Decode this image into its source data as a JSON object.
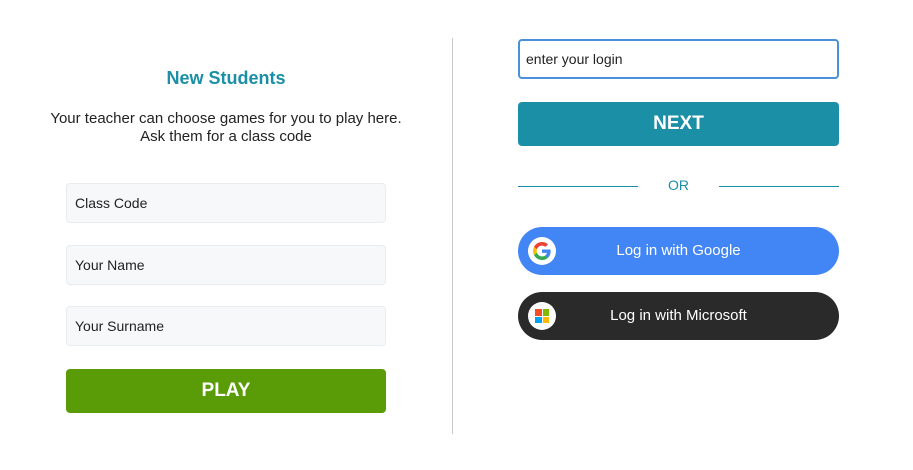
{
  "new_students": {
    "title": "New Students",
    "description_line1": "Your teacher can choose games for you to play here.",
    "description_line2": "Ask them for a class code",
    "class_code_placeholder": "Class Code",
    "name_placeholder": "Your Name",
    "surname_placeholder": "Your Surname",
    "play_label": "PLAY"
  },
  "login": {
    "login_placeholder": "enter your login",
    "next_label": "NEXT",
    "or_label": "OR",
    "google_label": "Log in with Google",
    "microsoft_label": "Log in with Microsoft"
  },
  "colors": {
    "accent": "#1a8fa6",
    "play_green": "#5a9c08",
    "google_blue": "#4285f4",
    "microsoft_dark": "#2a2a2a"
  },
  "icons": [
    "google-icon",
    "microsoft-icon"
  ]
}
